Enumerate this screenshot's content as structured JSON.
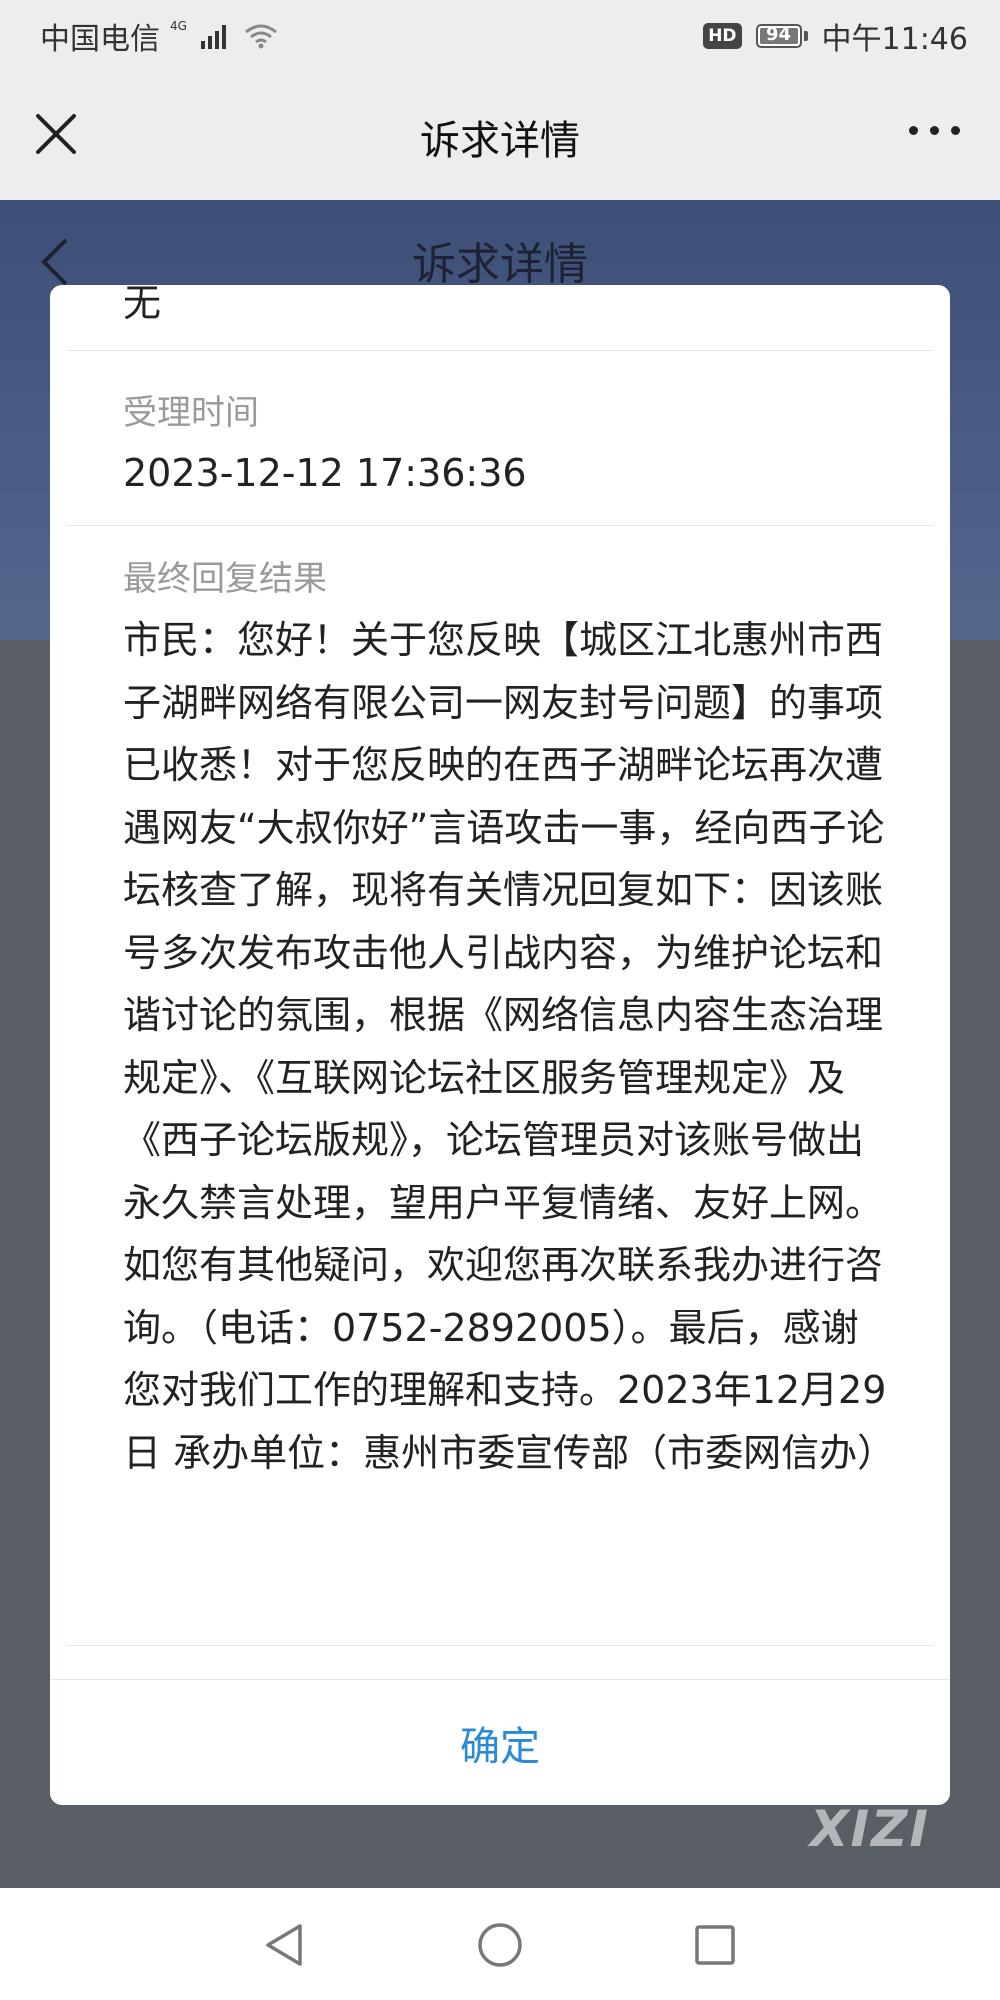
{
  "status_bar": {
    "carrier": "中国电信",
    "network_type": "4G",
    "signal_icon": "signal-bars-icon",
    "wifi_icon": "wifi-icon",
    "hd_badge": "HD",
    "battery_level": "94",
    "time": "中午11:46"
  },
  "header": {
    "title": "诉求详情",
    "close_icon": "close-icon",
    "more_icon": "more-dots-icon"
  },
  "background_page": {
    "title": "诉求详情",
    "back_icon": "chevron-left-icon",
    "watermark": "XIZI"
  },
  "dialog": {
    "partial_value": "无",
    "sections": [
      {
        "label": "受理时间",
        "value": "2023-12-12 17:36:36"
      },
      {
        "label": "最终回复结果",
        "value": "市民：您好！关于您反映【城区江北惠州市西子湖畔网络有限公司一网友封号问题】的事项已收悉！对于您反映的在西子湖畔论坛再次遭遇网友“大叔你好”言语攻击一事，经向西子论坛核查了解，现将有关情况回复如下：因该账号多次发布攻击他人引战内容，为维护论坛和谐讨论的氛围，根据《网络信息内容生态治理规定》、《互联网论坛社区服务管理规定》及《西子论坛版规》，论坛管理员对该账号做出永久禁言处理，望用户平复情绪、友好上网。如您有其他疑问，欢迎您再次联系我办进行咨询。（电话：0752-2892005）。最后，感谢您对我们工作的理解和支持。2023年12月29日 承办单位：惠州市委宣传部（市委网信办）"
      }
    ],
    "confirm_label": "确定"
  },
  "android_nav": {
    "back_icon": "triangle-back-icon",
    "home_icon": "circle-home-icon",
    "recents_icon": "square-recents-icon"
  },
  "colors": {
    "accent": "#2b8ad8",
    "overlay": "#5a5e66",
    "label_gray": "#9a9a9a"
  }
}
